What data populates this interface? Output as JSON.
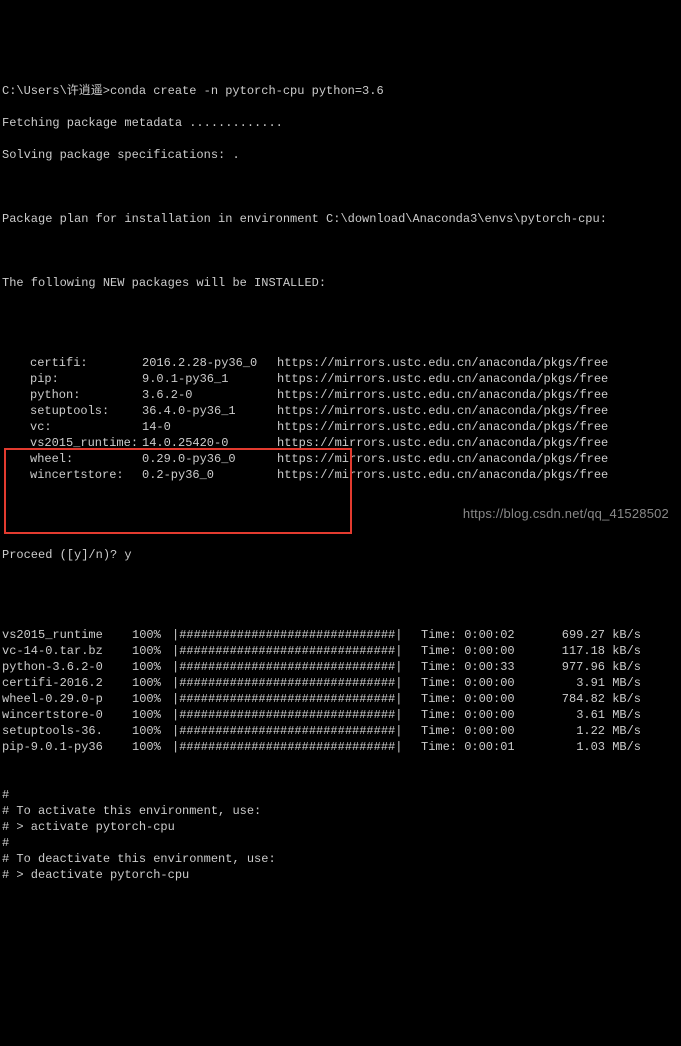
{
  "prompt_line": "C:\\Users\\许逍遥>conda create -n pytorch-cpu python=3.6",
  "fetch_line": "Fetching package metadata .............",
  "solve_line": "Solving package specifications: .",
  "plan_line": "Package plan for installation in environment C:\\download\\Anaconda3\\envs\\pytorch-cpu:",
  "new_pkgs_line": "The following NEW packages will be INSTALLED:",
  "packages": [
    {
      "name": "certifi:",
      "ver": "2016.2.28-py36_0",
      "url": "https://mirrors.ustc.edu.cn/anaconda/pkgs/free"
    },
    {
      "name": "pip:",
      "ver": "9.0.1-py36_1",
      "url": "https://mirrors.ustc.edu.cn/anaconda/pkgs/free"
    },
    {
      "name": "python:",
      "ver": "3.6.2-0",
      "url": "https://mirrors.ustc.edu.cn/anaconda/pkgs/free"
    },
    {
      "name": "setuptools:",
      "ver": "36.4.0-py36_1",
      "url": "https://mirrors.ustc.edu.cn/anaconda/pkgs/free"
    },
    {
      "name": "vc:",
      "ver": "14-0",
      "url": "https://mirrors.ustc.edu.cn/anaconda/pkgs/free"
    },
    {
      "name": "vs2015_runtime:",
      "ver": "14.0.25420-0",
      "url": "https://mirrors.ustc.edu.cn/anaconda/pkgs/free"
    },
    {
      "name": "wheel:",
      "ver": "0.29.0-py36_0",
      "url": "https://mirrors.ustc.edu.cn/anaconda/pkgs/free"
    },
    {
      "name": "wincertstore:",
      "ver": "0.2-py36_0",
      "url": "https://mirrors.ustc.edu.cn/anaconda/pkgs/free"
    }
  ],
  "proceed_line": "Proceed ([y]/n)? y",
  "bar": "|##############################|",
  "downloads": [
    {
      "name": "vs2015_runtime",
      "pct": "100%",
      "time": "Time: 0:00:02",
      "speed": "699.27 kB/s"
    },
    {
      "name": "vc-14-0.tar.bz",
      "pct": "100%",
      "time": "Time: 0:00:00",
      "speed": "117.18 kB/s"
    },
    {
      "name": "python-3.6.2-0",
      "pct": "100%",
      "time": "Time: 0:00:33",
      "speed": "977.96 kB/s"
    },
    {
      "name": "certifi-2016.2",
      "pct": "100%",
      "time": "Time: 0:00:00",
      "speed": "3.91 MB/s"
    },
    {
      "name": "wheel-0.29.0-p",
      "pct": "100%",
      "time": "Time: 0:00:00",
      "speed": "784.82 kB/s"
    },
    {
      "name": "wincertstore-0",
      "pct": "100%",
      "time": "Time: 0:00:00",
      "speed": "3.61 MB/s"
    },
    {
      "name": "setuptools-36.",
      "pct": "100%",
      "time": "Time: 0:00:00",
      "speed": "1.22 MB/s"
    },
    {
      "name": "pip-9.0.1-py36",
      "pct": "100%",
      "time": "Time: 0:00:01",
      "speed": "1.03 MB/s"
    }
  ],
  "tips": [
    "#",
    "# To activate this environment, use:",
    "# > activate pytorch-cpu",
    "#",
    "# To deactivate this environment, use:",
    "# > deactivate pytorch-cpu"
  ],
  "watermark": "https://blog.csdn.net/qq_41528502"
}
